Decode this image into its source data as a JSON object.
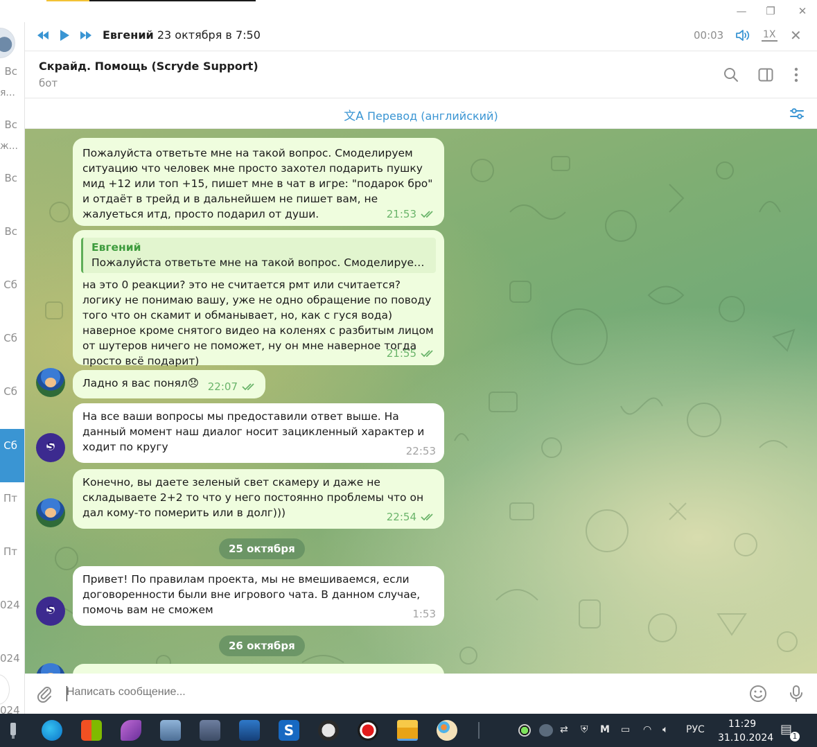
{
  "window": {
    "minimize_glyph": "—",
    "restore_glyph": "❐",
    "close_glyph": "✕"
  },
  "left_strip": {
    "rows": [
      "Вс",
      "я...",
      "Вс",
      "ж...",
      "Вс",
      "Вс",
      "Сб",
      "Сб",
      "Сб",
      "Сб",
      "Пт",
      "Пт",
      "024",
      "024",
      "024"
    ],
    "active_index": 9
  },
  "player": {
    "title_name": "Евгений",
    "title_date": "23 октября в 7:50",
    "elapsed": "00:03",
    "speed": "1X",
    "icons": [
      "rewind-icon",
      "play-icon",
      "fast-forward-icon",
      "volume-icon",
      "close-icon"
    ]
  },
  "chat": {
    "name": "Скрайд. Помощь (Scryde Support)",
    "status": "бот",
    "icons": [
      "search-icon",
      "sidebar-toggle-icon",
      "more-vertical-icon"
    ]
  },
  "translate": {
    "label": "Перевод (английский)",
    "icons": [
      "translate-icon",
      "settings-sliders-icon"
    ]
  },
  "messages": [
    {
      "side": "out",
      "text": "Пожалуйста ответьте мне на такой вопрос. Смоделируем ситуацию что человек мне просто захотел подарить пушку мид +12 или топ +15,  пишет мне в чат в игре: \"подарок бро\" и отдаёт в трейд и в дальнейшем не пишет вам, не жалуеться итд, просто подарил от души.",
      "time": "21:53"
    },
    {
      "side": "out",
      "reply_name": "Евгений",
      "reply_text": "Пожалуйста ответьте мне на такой вопрос. Смоделируем си...",
      "text": "на это 0 реакции? это не считается рмт или считается?  логику не понимаю вашу, уже не одно обращение по поводу того что он скамит и обманывает, но, как с гуся вода) наверное кроме снятого видео на коленях с разбитым лицом от шутеров ничего не поможет, ну он мне наверное тогда просто всё подарит)",
      "time": "21:55"
    },
    {
      "side": "out",
      "text": "Ладно я вас понял😞",
      "time": "22:07"
    },
    {
      "side": "in",
      "text": "На все ваши вопросы мы предоставили ответ выше. На данный момент наш диалог носит зацикленный характер и ходит по кругу",
      "time": "22:53"
    },
    {
      "side": "out",
      "text": "Конечно, вы даете зеленый свет скамеру и даже не складываете 2+2 то что у него постоянно проблемы что он дал кому-то померить или в долг)))",
      "time": "22:54"
    },
    {
      "side": "in",
      "text": "Привет! По правилам проекта, мы не вмешиваемся, если договоренности были вне игрового чата. В данном случае, помочь вам не сможем",
      "time": "1:53"
    }
  ],
  "dates": [
    "25 октября",
    "26 октября"
  ],
  "input": {
    "placeholder": "Написать сообщение...",
    "icons": [
      "attach-icon",
      "emoji-icon",
      "microphone-icon"
    ]
  },
  "taskbar": {
    "apps": [
      "usb-icon",
      "edge-icon",
      "store-icon",
      "feather-app-icon",
      "monitor-app-icon",
      "calculator-icon",
      "window-app-icon",
      "scryde-icon",
      "server-app-icon",
      "record-icon",
      "file-explorer-icon",
      "paint-icon"
    ],
    "language": "РУС",
    "time": "11:29",
    "date": "31.10.2024",
    "notification_count": "1"
  }
}
